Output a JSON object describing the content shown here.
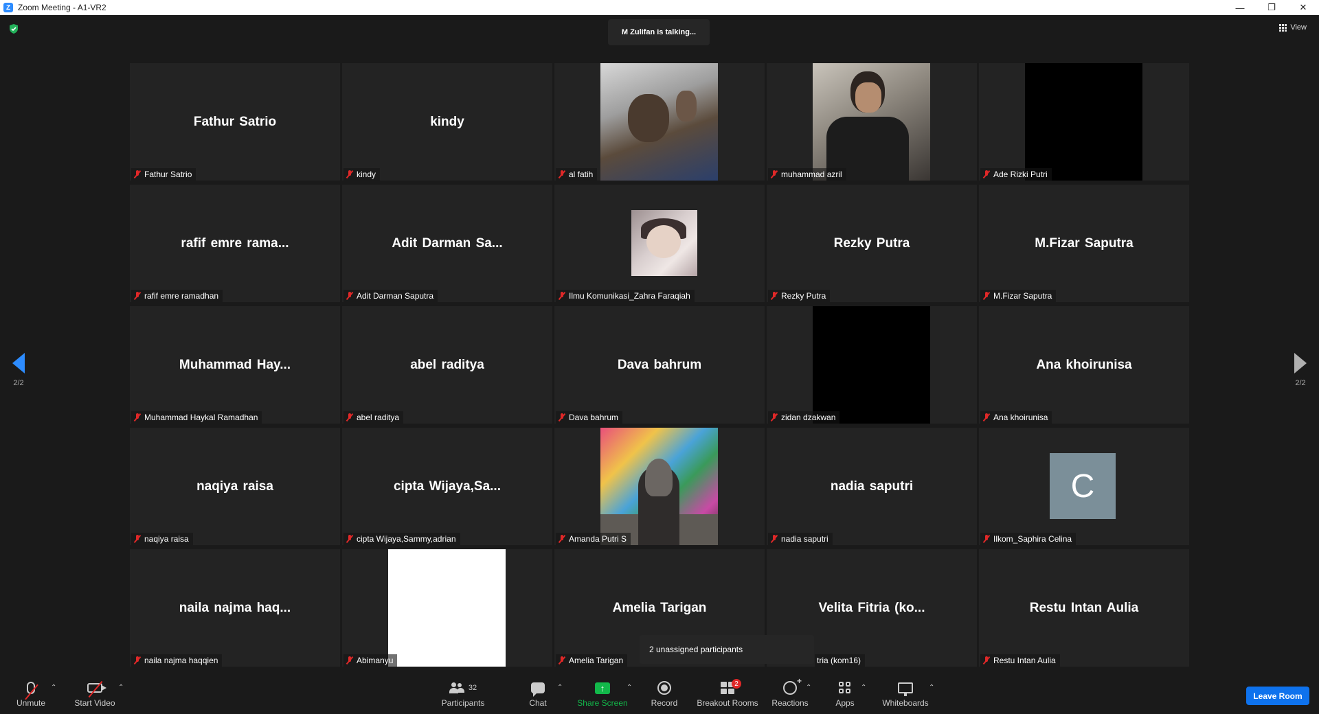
{
  "window": {
    "title": "Zoom Meeting - A1-VR2",
    "controls": [
      "minimize",
      "restore",
      "close"
    ]
  },
  "top": {
    "talking_text": "M Zulifan is talking...",
    "view_label": "View"
  },
  "nav": {
    "page_left": "2/2",
    "page_right": "2/2"
  },
  "tiles": [
    {
      "display": "Fathur Satrio",
      "label": "Fathur Satrio",
      "video": "none"
    },
    {
      "display": "kindy",
      "label": "kindy",
      "video": "none"
    },
    {
      "display": "",
      "label": "al fatih",
      "video": "photo"
    },
    {
      "display": "",
      "label": "muhammad azril",
      "video": "photo"
    },
    {
      "display": "",
      "label": "Ade Rizki Putri",
      "video": "black"
    },
    {
      "display": "rafif emre rama...",
      "label": "rafif emre ramadhan",
      "video": "none"
    },
    {
      "display": "Adit Darman Sa...",
      "label": "Adit Darman Saputra",
      "video": "none"
    },
    {
      "display": "",
      "label": "Ilmu Komunikasi_Zahra Faraqiah",
      "video": "profile-photo"
    },
    {
      "display": "Rezky Putra",
      "label": "Rezky Putra",
      "video": "none"
    },
    {
      "display": "M.Fizar Saputra",
      "label": "M.Fizar Saputra",
      "video": "none"
    },
    {
      "display": "Muhammad Hay...",
      "label": "Muhammad Haykal Ramadhan",
      "video": "none"
    },
    {
      "display": "abel raditya",
      "label": "abel raditya",
      "video": "none"
    },
    {
      "display": "Dava bahrum",
      "label": "Dava bahrum",
      "video": "none"
    },
    {
      "display": "",
      "label": "zidan dzakwan",
      "video": "black"
    },
    {
      "display": "Ana khoirunisa",
      "label": "Ana khoirunisa",
      "video": "none"
    },
    {
      "display": "naqiya raisa",
      "label": "naqiya raisa",
      "video": "none"
    },
    {
      "display": "cipta Wijaya,Sa...",
      "label": "cipta Wijaya,Sammy,adrian",
      "video": "none"
    },
    {
      "display": "",
      "label": "Amanda Putri S",
      "video": "photo"
    },
    {
      "display": "nadia saputri",
      "label": "nadia saputri",
      "video": "none"
    },
    {
      "display": "",
      "label": "Ilkom_Saphira Celina",
      "video": "avatar",
      "avatar_letter": "C"
    },
    {
      "display": "naila najma haq...",
      "label": "naila najma haqqien",
      "video": "none"
    },
    {
      "display": "",
      "label": "Abimanyu",
      "video": "white"
    },
    {
      "display": "Amelia Tarigan",
      "label": "Amelia Tarigan",
      "video": "none"
    },
    {
      "display": "Velita Fitria (ko...",
      "label": "tria (kom16)",
      "video": "none"
    },
    {
      "display": "Restu Intan Aulia",
      "label": "Restu Intan Aulia",
      "video": "none"
    }
  ],
  "tooltip": {
    "text": "2 unassigned participants"
  },
  "toolbar": {
    "unmute": "Unmute",
    "start_video": "Start Video",
    "participants": "Participants",
    "participants_count": "32",
    "chat": "Chat",
    "share_screen": "Share Screen",
    "record": "Record",
    "breakout_rooms": "Breakout Rooms",
    "breakout_badge": "2",
    "reactions": "Reactions",
    "apps": "Apps",
    "whiteboards": "Whiteboards",
    "leave": "Leave Room"
  },
  "colors": {
    "background": "#1a1a1a",
    "tile": "#232323",
    "accent": "#2d8cff",
    "share_green": "#12b84a",
    "muted_red": "#e02828",
    "leave_blue": "#0e72ed"
  }
}
